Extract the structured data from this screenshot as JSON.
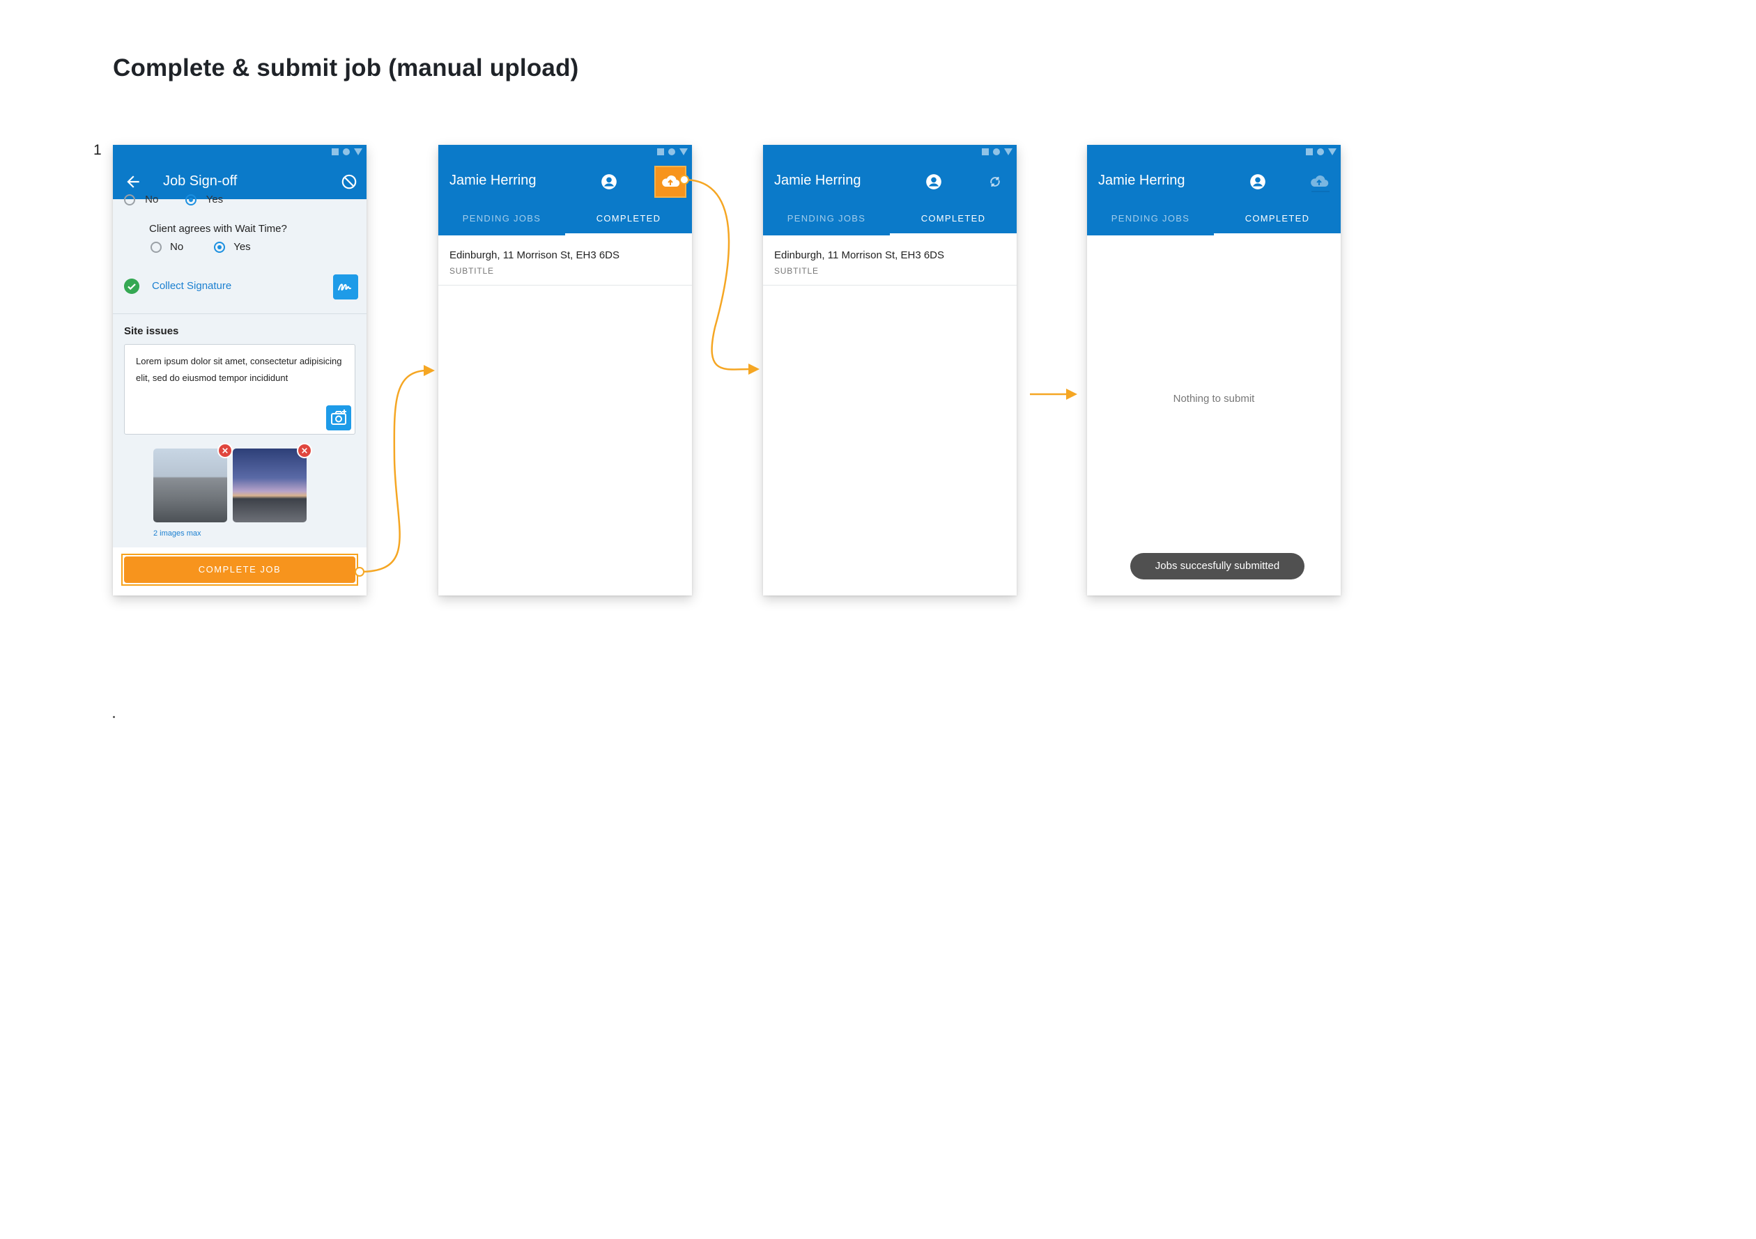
{
  "page_title": "Complete & submit job (manual upload)",
  "step_number": "1",
  "screen1": {
    "title": "Job Sign-off",
    "cut_radio_no": "No",
    "cut_radio_yes": "Yes",
    "question": "Client agrees with Wait Time?",
    "option_no": "No",
    "option_yes": "Yes",
    "selected_option": "Yes",
    "signature_label": "Collect Signature",
    "site_issues_label": "Site issues",
    "site_issues_text": "Lorem ipsum dolor sit amet, consectetur adipisicing elit, sed do eiusmod tempor incididunt",
    "images_hint": "2 images max",
    "complete_button": "COMPLETE JOB"
  },
  "screen2": {
    "user_name": "Jamie Herring",
    "tab_pending": "PENDING JOBS",
    "tab_completed": "COMPLETED",
    "active_tab": "COMPLETED",
    "item_title": "Edinburgh, 11 Morrison St, EH3 6DS",
    "item_subtitle": "SUBTITLE",
    "action_icon": "cloud-upload-icon"
  },
  "screen3": {
    "user_name": "Jamie Herring",
    "tab_pending": "PENDING JOBS",
    "tab_completed": "COMPLETED",
    "active_tab": "COMPLETED",
    "item_title": "Edinburgh, 11 Morrison St, EH3 6DS",
    "item_subtitle": "SUBTITLE",
    "action_icon": "sync-icon"
  },
  "screen4": {
    "user_name": "Jamie Herring",
    "tab_pending": "PENDING JOBS",
    "tab_completed": "COMPLETED",
    "active_tab": "COMPLETED",
    "empty_text": "Nothing to submit",
    "toast": "Jobs succesfully submitted",
    "action_icon": "cloud-upload-disabled-icon"
  },
  "colors": {
    "app_bar": "#0b7ac9",
    "accent_orange": "#f7941d",
    "icon_button_blue": "#1e9be8",
    "success_green": "#35a853",
    "delete_red": "#e0463e"
  }
}
